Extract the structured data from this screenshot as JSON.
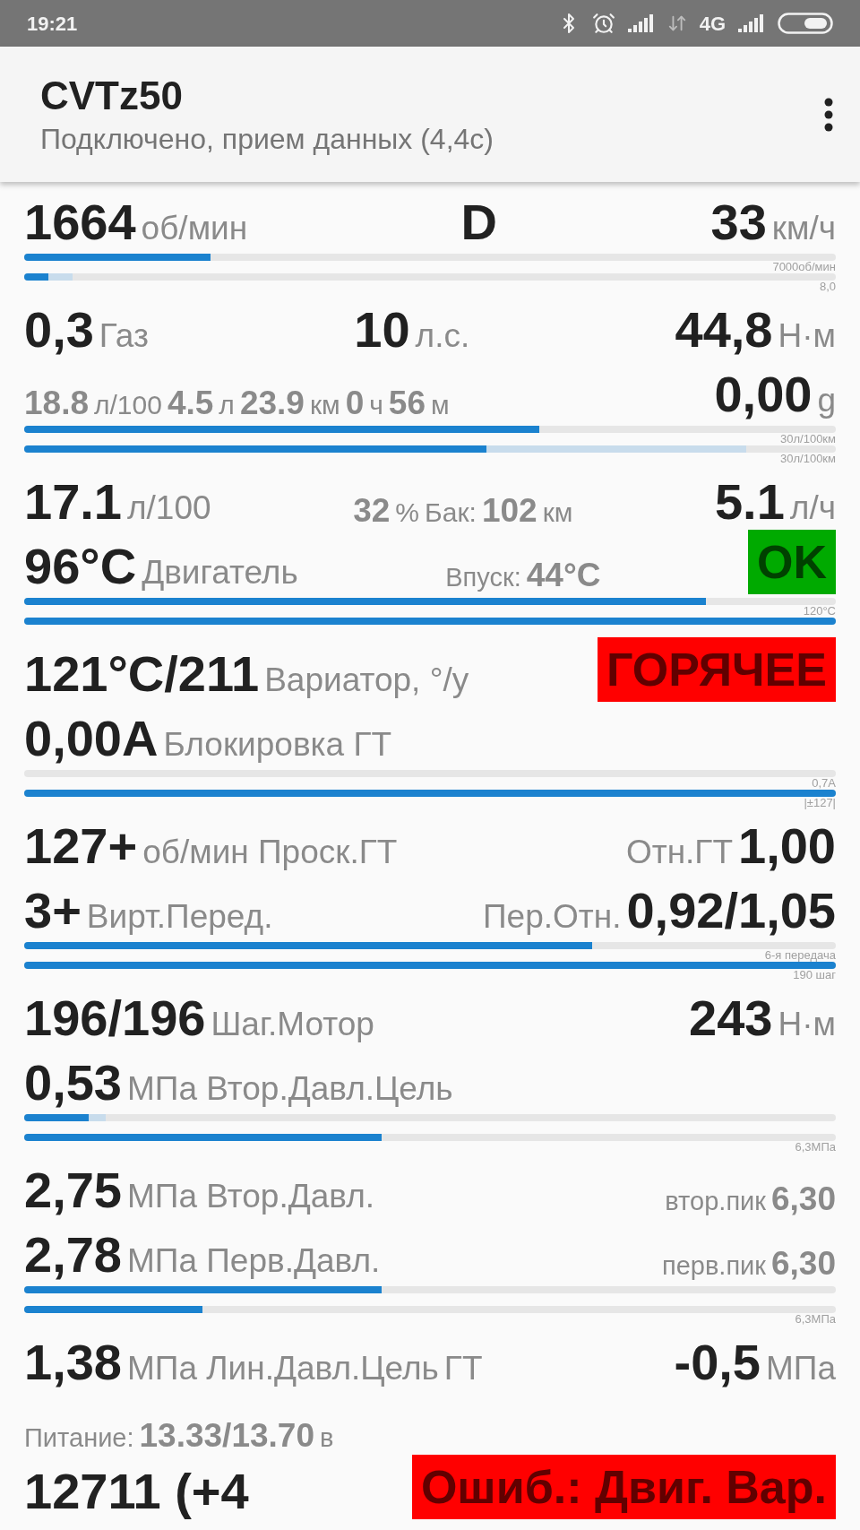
{
  "status_bar": {
    "time": "19:21",
    "network": "4G"
  },
  "app_bar": {
    "title": "CVTz50",
    "subtitle": "Подключено, прием данных (4,4с)"
  },
  "rows": [
    {
      "items": [
        {
          "kind": "text",
          "parts": [
            {
              "kind": "value",
              "text": "1664"
            },
            {
              "kind": "unit",
              "text": "об/мин"
            }
          ]
        },
        {
          "kind": "text",
          "parts": [
            {
              "kind": "value",
              "text": "D"
            }
          ]
        },
        {
          "kind": "text",
          "parts": [
            {
              "kind": "value",
              "text": "33"
            },
            {
              "kind": "unit",
              "text": "км/ч"
            }
          ]
        }
      ],
      "bars": [
        {
          "level": 0.23,
          "caption": "7000об/мин"
        },
        {
          "level": 0.03,
          "peak": {
            "level": 0.06
          },
          "caption": "8,0"
        }
      ]
    },
    {
      "items": [
        {
          "kind": "text",
          "parts": [
            {
              "kind": "value",
              "text": "0,3"
            },
            {
              "kind": "unit",
              "text": "Газ"
            }
          ]
        },
        {
          "kind": "text",
          "parts": [
            {
              "kind": "value",
              "text": "10"
            },
            {
              "kind": "unit",
              "text": "л.с."
            }
          ]
        },
        {
          "kind": "text",
          "parts": [
            {
              "kind": "value",
              "text": "44,8"
            },
            {
              "kind": "unit",
              "text": "Н·м"
            }
          ]
        }
      ]
    },
    {
      "items": [
        {
          "kind": "text",
          "parts": [
            {
              "kind": "minor_value",
              "text": "18.8"
            },
            {
              "kind": "minor_unit",
              "text": "л/100"
            },
            {
              "kind": "minor_value",
              "text": "4.5"
            },
            {
              "kind": "minor_unit",
              "text": "л"
            },
            {
              "kind": "minor_value",
              "text": "23.9"
            },
            {
              "kind": "minor_unit",
              "text": "км"
            },
            {
              "kind": "minor_value",
              "text": "0"
            },
            {
              "kind": "minor_unit",
              "text": "ч"
            },
            {
              "kind": "minor_value",
              "text": "56"
            },
            {
              "kind": "minor_unit",
              "text": "м"
            }
          ]
        },
        {
          "kind": "text",
          "parts": [
            {
              "kind": "value",
              "text": "0,00"
            },
            {
              "kind": "unit",
              "text": "g"
            }
          ]
        }
      ],
      "bars": [
        {
          "level": 0.635,
          "caption": "30л/100км"
        },
        {
          "level": 0.57,
          "peak": {
            "level": 0.89
          },
          "caption": "30л/100км"
        }
      ]
    },
    {
      "items": [
        {
          "kind": "text",
          "parts": [
            {
              "kind": "value",
              "text": "17.1"
            },
            {
              "kind": "unit",
              "text": "л/100"
            }
          ]
        },
        {
          "kind": "text",
          "parts": [
            {
              "kind": "minor_value",
              "text": "32"
            },
            {
              "kind": "minor_unit",
              "text": "%"
            },
            {
              "kind": "minor_unit",
              "text": "Бак:"
            },
            {
              "kind": "minor_value",
              "text": "102"
            },
            {
              "kind": "minor_unit",
              "text": "км"
            }
          ]
        },
        {
          "kind": "text",
          "parts": [
            {
              "kind": "value",
              "text": "5.1"
            },
            {
              "kind": "unit",
              "text": "л/ч"
            }
          ]
        }
      ]
    },
    {
      "items": [
        {
          "kind": "text",
          "parts": [
            {
              "kind": "value",
              "text": "96°C"
            },
            {
              "kind": "unit",
              "text": "Двигатель"
            }
          ]
        },
        {
          "kind": "text",
          "parts": [
            {
              "kind": "small_label",
              "text": "Впуск:"
            },
            {
              "kind": "minor_value",
              "text": "44°C"
            }
          ]
        },
        {
          "kind": "badge",
          "text": "OK",
          "color": "#00aa00"
        }
      ],
      "bars": [
        {
          "level": 0.84,
          "caption": "120°C"
        },
        {
          "level": 1.0
        }
      ]
    },
    {
      "items": [
        {
          "kind": "text",
          "parts": [
            {
              "kind": "value",
              "text": "121°C/211"
            },
            {
              "kind": "unit",
              "text": "Вариатор, °/у"
            }
          ]
        },
        {
          "kind": "badge",
          "text": "ГОРЯЧЕЕ",
          "color": "#ff0000"
        }
      ]
    },
    {
      "items": [
        {
          "kind": "text",
          "parts": [
            {
              "kind": "value",
              "text": "0,00A"
            },
            {
              "kind": "unit",
              "text": "Блокировка ГТ"
            }
          ]
        }
      ],
      "bars": [
        {
          "level": 0.0,
          "caption": "0,7A"
        },
        {
          "level": 1.0,
          "caption": "|±127|"
        }
      ]
    },
    {
      "items": [
        {
          "kind": "text",
          "parts": [
            {
              "kind": "value",
              "text": "127+"
            },
            {
              "kind": "unit",
              "text": "об/мин Проск.ГТ"
            }
          ]
        },
        {
          "kind": "text",
          "parts": [
            {
              "kind": "unit",
              "text": "Отн.ГТ"
            },
            {
              "kind": "value",
              "text": "1,00"
            }
          ]
        }
      ]
    },
    {
      "items": [
        {
          "kind": "text",
          "parts": [
            {
              "kind": "value",
              "text": "3+"
            },
            {
              "kind": "unit",
              "text": "Вирт.Перед."
            }
          ]
        },
        {
          "kind": "text",
          "parts": [
            {
              "kind": "unit",
              "text": "Пер.Отн."
            },
            {
              "kind": "value",
              "text": "0,92/1,05"
            }
          ]
        }
      ],
      "bars": [
        {
          "level": 0.7,
          "caption": "6-я передача"
        },
        {
          "level": 1.0,
          "caption": "190 шаг"
        }
      ]
    },
    {
      "items": [
        {
          "kind": "text",
          "parts": [
            {
              "kind": "value",
              "text": "196/196"
            },
            {
              "kind": "unit",
              "text": "Шаг.Мотор"
            }
          ]
        },
        {
          "kind": "text",
          "parts": [
            {
              "kind": "value",
              "text": "243"
            },
            {
              "kind": "unit",
              "text": "Н·м"
            }
          ]
        }
      ]
    },
    {
      "items": [
        {
          "kind": "text",
          "parts": [
            {
              "kind": "value",
              "text": "0,53"
            },
            {
              "kind": "unit",
              "text": "МПа Втор.Давл.Цель"
            }
          ]
        }
      ],
      "bars": [
        {
          "level": 0.08,
          "peak": {
            "level": 0.1
          }
        },
        {
          "level": 0.44,
          "caption": "6,3МПа"
        }
      ]
    },
    {
      "items": [
        {
          "kind": "text",
          "parts": [
            {
              "kind": "value",
              "text": "2,75"
            },
            {
              "kind": "unit",
              "text": "МПа Втор.Давл."
            }
          ]
        },
        {
          "kind": "text",
          "parts": [
            {
              "kind": "small_label",
              "text": "втор.пик"
            },
            {
              "kind": "minor_value",
              "text": "6,30"
            }
          ]
        }
      ]
    },
    {
      "items": [
        {
          "kind": "text",
          "parts": [
            {
              "kind": "value",
              "text": "2,78"
            },
            {
              "kind": "unit",
              "text": "МПа Перв.Давл."
            }
          ]
        },
        {
          "kind": "text",
          "parts": [
            {
              "kind": "small_label",
              "text": "перв.пик"
            },
            {
              "kind": "minor_value",
              "text": "6,30"
            }
          ]
        }
      ],
      "bars": [
        {
          "level": 0.44
        },
        {
          "level": 0.22,
          "caption": "6,3МПа"
        }
      ]
    },
    {
      "items": [
        {
          "kind": "text",
          "parts": [
            {
              "kind": "value",
              "text": "1,38"
            },
            {
              "kind": "unit",
              "text": "МПа Лин.Давл.Цель"
            },
            {
              "kind": "unit",
              "text": "ГТ"
            }
          ]
        },
        {
          "kind": "text",
          "parts": [
            {
              "kind": "value",
              "text": "-0,5"
            },
            {
              "kind": "unit",
              "text": "МПа"
            }
          ]
        }
      ]
    },
    {
      "items": [
        {
          "kind": "text",
          "parts": [
            {
              "kind": "small_label",
              "text": "Питание:"
            },
            {
              "kind": "minor_value",
              "text": "13.33/13.70"
            },
            {
              "kind": "small_label",
              "text": "в"
            }
          ]
        }
      ]
    },
    {
      "items": [
        {
          "kind": "text",
          "parts": [
            {
              "kind": "value",
              "text": "12711 (+4"
            }
          ]
        },
        {
          "kind": "badge",
          "text": "Ошиб.: Двиг. Вар.",
          "color": "#ff0000"
        }
      ]
    }
  ]
}
